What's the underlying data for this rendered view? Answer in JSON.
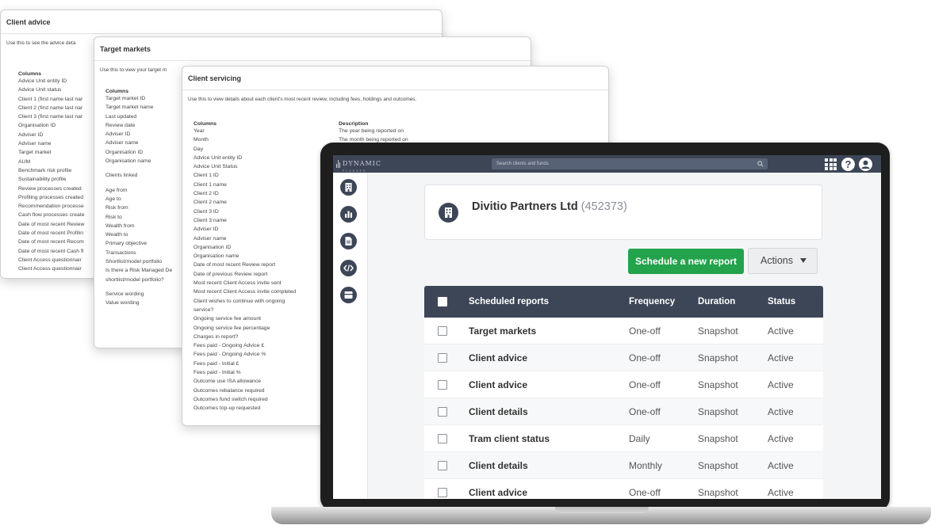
{
  "cards": {
    "client_advice": {
      "title": "Client advice",
      "description": "Use this to see the advice deta",
      "columns_heading": "Columns",
      "columns": [
        "Advice Unit entity ID",
        "Advice Unit status",
        "Client 1 (first name last nar",
        "Client 2 (first name last nar",
        "Client 3 (first name last nar",
        "Organisation ID",
        "Adviser ID",
        "Adviser name",
        "Target market",
        "AUM",
        "Benchmark risk profile",
        "Sustainability profile",
        "Review processes created",
        "Profiling processes created",
        "Recommendation processe",
        "Cash flow processes create",
        "Date of most recent Review",
        "Date of most recent Profilin",
        "Date of most recent Recom",
        "Date of most recent Cash fl",
        "Client Access questionnair",
        "Client Access questionnair"
      ]
    },
    "target_markets": {
      "title": "Target markets",
      "description": "Use this to view your target m",
      "columns_heading": "Columns",
      "columns": [
        "Target market ID",
        "Target market name",
        "Last updated",
        "Review date",
        "Adviser ID",
        "Adviser name",
        "Organisation ID",
        "Organisation name",
        "Clients linked",
        "Age from",
        "Age to",
        "Risk from",
        "Risk to",
        "Wealth from",
        "Wealth to",
        "Primary objective",
        "Transactions",
        "Shortlist/model portfolio",
        "Is there a Risk Managed De",
        "shortlist/model portfolio?",
        "Service wording",
        "Value wording"
      ]
    },
    "client_servicing": {
      "title": "Client servicing",
      "description": "Use this to view details about each client's most recent review, including fees, holdings and outcomes.",
      "columns_heading": "Columns",
      "description_heading": "Description",
      "columns": [
        "Year",
        "Month",
        "Day",
        "Advice Unit entity ID",
        "Advice Unit Status",
        "Client 1 ID",
        "Client 1 name",
        "Client 2 ID",
        "Client 2 name",
        "Client 3 ID",
        "Client 3 name",
        "Adviser ID",
        "Adviser name",
        "Organisation ID",
        "Organisation name",
        "Date of most recent Review report",
        "Date of previous Review report",
        "Most recent Client Access invite sent",
        "Most recent Client Access invite completed",
        "Client wishes to continue with ongoing",
        "service?",
        "Ongoing service fee amount",
        "Ongoing service fee percentage",
        "Charges in report?",
        "Fees paid - Ongoing Advice £",
        "Fees paid - Ongoing Advice %",
        "Fees paid - Initial £",
        "Fees paid - Initial %",
        "Outcome use ISA allowance",
        "Outcomes rebalance required",
        "Outcomes fund switch required",
        "Outcomes top-up requested"
      ],
      "descriptions": [
        "The year being reported on",
        "The month being reported on"
      ]
    }
  },
  "app": {
    "logo_text": "DYNAMIC",
    "logo_subtext": "PLANNER",
    "search_placeholder": "Search clients and funds",
    "help_label": "?",
    "company": {
      "name": "Divitio Partners Ltd",
      "id": "(452373)"
    },
    "schedule_button": "Schedule a new report",
    "actions_button": "Actions",
    "table": {
      "headers": {
        "name": "Scheduled reports",
        "frequency": "Frequency",
        "duration": "Duration",
        "status": "Status"
      },
      "rows": [
        {
          "name": "Target markets",
          "frequency": "One-off",
          "duration": "Snapshot",
          "status": "Active"
        },
        {
          "name": "Client advice",
          "frequency": "One-off",
          "duration": "Snapshot",
          "status": "Active"
        },
        {
          "name": "Client advice",
          "frequency": "One-off",
          "duration": "Snapshot",
          "status": "Active"
        },
        {
          "name": "Client details",
          "frequency": "One-off",
          "duration": "Snapshot",
          "status": "Active"
        },
        {
          "name": "Tram client status",
          "frequency": "Daily",
          "duration": "Snapshot",
          "status": "Active"
        },
        {
          "name": "Client details",
          "frequency": "Monthly",
          "duration": "Snapshot",
          "status": "Active"
        },
        {
          "name": "Client advice",
          "frequency": "One-off",
          "duration": "Snapshot",
          "status": "Active"
        }
      ]
    },
    "side_nav_icons": [
      "building-icon",
      "chart-icon",
      "document-icon",
      "code-icon",
      "archive-icon"
    ],
    "colors": {
      "nav": "#3d4657",
      "primary_button": "#23a34b",
      "table_header": "#3d4657"
    }
  }
}
